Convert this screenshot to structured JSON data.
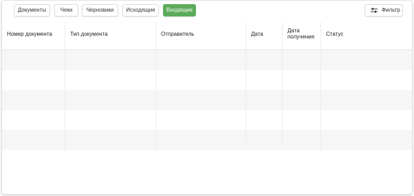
{
  "tabs": [
    {
      "label": "Документы",
      "active": false
    },
    {
      "label": "Чеки",
      "active": false
    },
    {
      "label": "Черновики",
      "active": false
    },
    {
      "label": "Исходящие",
      "active": false
    },
    {
      "label": "Входящие",
      "active": true
    }
  ],
  "filter": {
    "label": "Фильтр",
    "icon": "filter-sliders-icon"
  },
  "table": {
    "columns": [
      {
        "label": "Номер документа"
      },
      {
        "label": "Тип документа"
      },
      {
        "label": "Отправитель"
      },
      {
        "label": "Дата"
      },
      {
        "label": "Дата получения"
      },
      {
        "label": "Статус"
      }
    ],
    "rows": [
      [
        "",
        "",
        "",
        "",
        "",
        ""
      ],
      [
        "",
        "",
        "",
        "",
        "",
        ""
      ],
      [
        "",
        "",
        "",
        "",
        "",
        ""
      ],
      [
        "",
        "",
        "",
        "",
        "",
        ""
      ],
      [
        "",
        "",
        "",
        "",
        "",
        ""
      ]
    ]
  },
  "colors": {
    "accent": "#5cab5c",
    "stripe": "#f6f6f6",
    "border": "#dcdcdc"
  }
}
